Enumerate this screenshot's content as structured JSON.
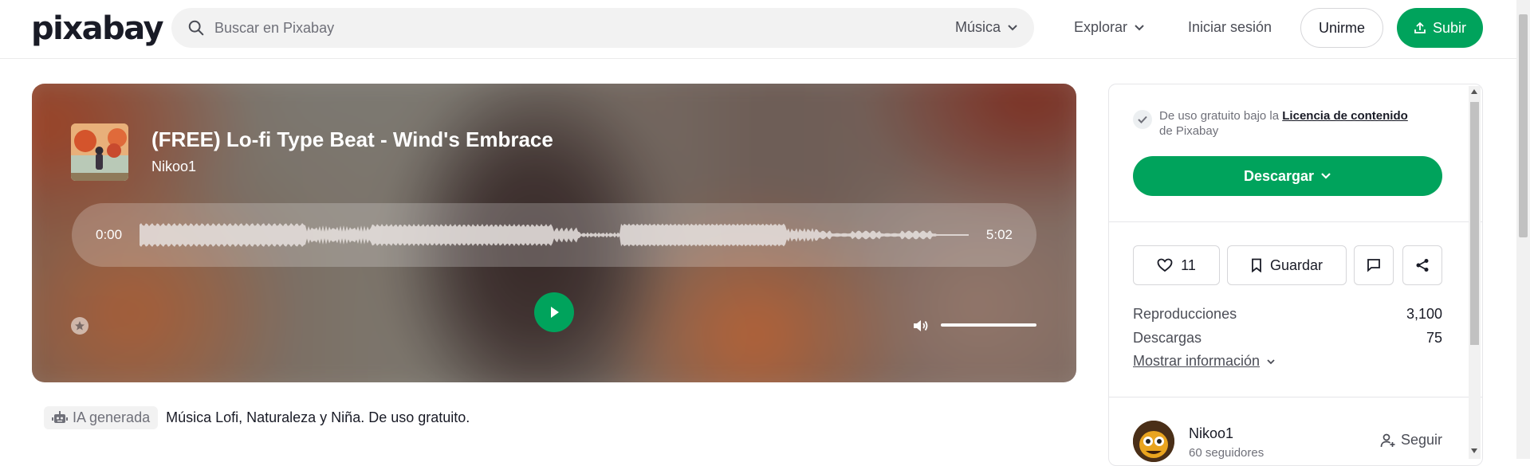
{
  "header": {
    "logo": "pixabay",
    "search_placeholder": "Buscar en Pixabay",
    "search_scope": "Música",
    "explore_label": "Explorar",
    "login_label": "Iniciar sesión",
    "join_label": "Unirme",
    "upload_label": "Subir"
  },
  "player": {
    "title": "(FREE) Lo-fi Type Beat - Wind's Embrace",
    "artist": "Nikoo1",
    "time_current": "0:00",
    "time_total": "5:02",
    "volume_level": 1.0
  },
  "description": {
    "ai_badge": "IA generada",
    "text": "Música Lofi, Naturaleza y Niña. De uso gratuito."
  },
  "sidebar": {
    "license_prefix": "De uso gratuito bajo la ",
    "license_link": "Licencia de contenido",
    "license_suffix": "de Pixabay",
    "download_label": "Descargar",
    "likes_count": "11",
    "save_label": "Guardar",
    "stats": [
      {
        "label": "Reproducciones",
        "value": "3,100"
      },
      {
        "label": "Descargas",
        "value": "75"
      }
    ],
    "more_info_label": "Mostrar información",
    "author_name": "Nikoo1",
    "author_followers": "60 seguidores",
    "follow_label": "Seguir"
  },
  "colors": {
    "brand_green": "#00a35c",
    "text_dark": "#191b26",
    "text_muted": "#6f7079"
  },
  "icons": [
    "search-icon",
    "chevron-down-icon",
    "upload-icon",
    "play-icon",
    "star-icon",
    "volume-icon",
    "check-icon",
    "heart-icon",
    "bookmark-icon",
    "comment-icon",
    "share-icon",
    "robot-icon",
    "user-plus-icon"
  ]
}
